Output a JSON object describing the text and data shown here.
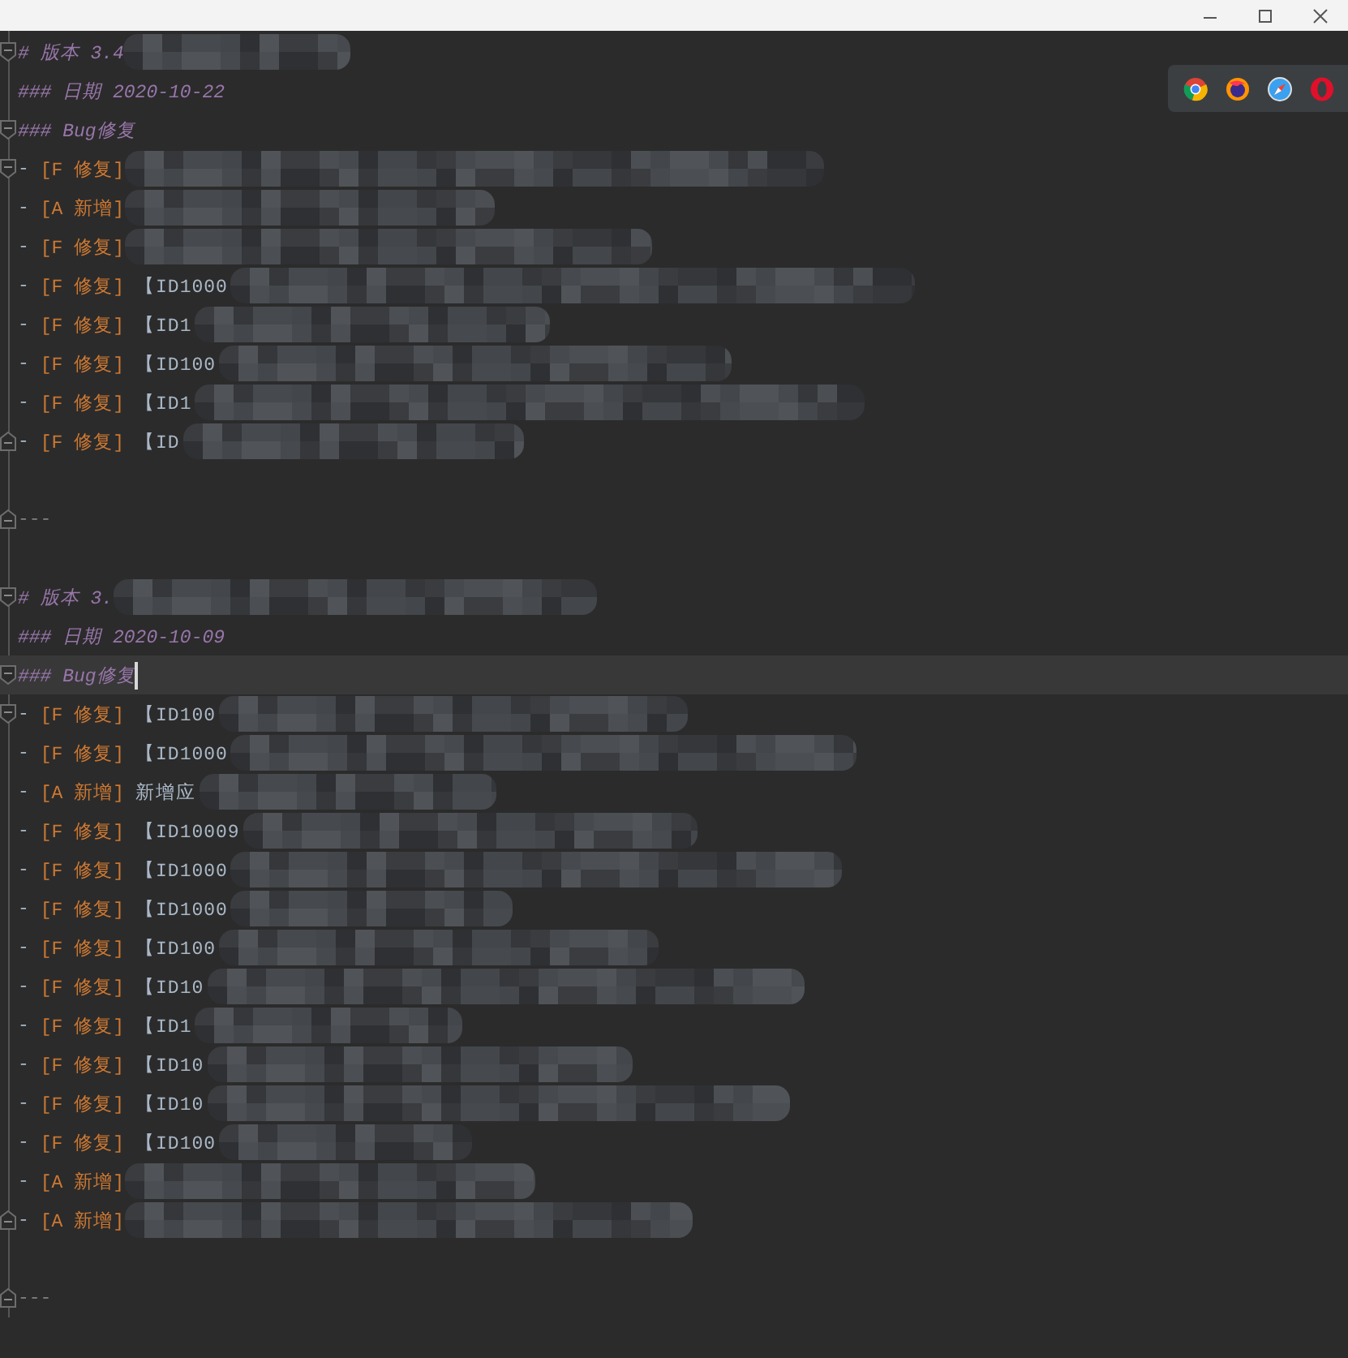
{
  "lines": [
    {
      "kind": "heading",
      "text": "# 版本 3.4",
      "redacted": true,
      "fold_start": true,
      "fold_end": false,
      "current": false
    },
    {
      "kind": "date",
      "text": "### 日期 2020-10-22",
      "redacted": false,
      "fold_start": false,
      "fold_end": false,
      "current": false
    },
    {
      "kind": "section",
      "text": "### Bug修复",
      "redacted": false,
      "fold_start": true,
      "fold_end": false,
      "current": false
    },
    {
      "kind": "item",
      "marker": "-",
      "tag": "[F 修复]",
      "redacted": true,
      "fold_start": true,
      "fold_end": false,
      "current": false
    },
    {
      "kind": "item",
      "marker": "-",
      "tag": "[A 新增]",
      "redacted": true,
      "fold_start": false,
      "fold_end": false,
      "current": false
    },
    {
      "kind": "item",
      "marker": "-",
      "tag": "[F 修复]",
      "redacted": true,
      "fold_start": false,
      "fold_end": false,
      "current": false
    },
    {
      "kind": "item",
      "marker": "-",
      "tag": "[F 修复]",
      "text": "【ID1000",
      "redacted": true,
      "fold_start": false,
      "fold_end": false,
      "current": false
    },
    {
      "kind": "item",
      "marker": "-",
      "tag": "[F 修复]",
      "text": "【ID1",
      "redacted": true,
      "fold_start": false,
      "fold_end": false,
      "current": false
    },
    {
      "kind": "item",
      "marker": "-",
      "tag": "[F 修复]",
      "text": "【ID100",
      "redacted": true,
      "fold_start": false,
      "fold_end": false,
      "current": false
    },
    {
      "kind": "item",
      "marker": "-",
      "tag": "[F 修复]",
      "text": "【ID1",
      "redacted": true,
      "fold_start": false,
      "fold_end": false,
      "current": false
    },
    {
      "kind": "item",
      "marker": "-",
      "tag": "[F 修复]",
      "text": "【ID",
      "redacted": true,
      "fold_start": false,
      "fold_end": true,
      "current": false
    },
    {
      "kind": "blank",
      "redacted": false,
      "fold_start": false,
      "fold_end": false,
      "current": false
    },
    {
      "kind": "rule",
      "text": "---",
      "redacted": false,
      "fold_start": false,
      "fold_end": true,
      "current": false
    },
    {
      "kind": "blank",
      "redacted": false,
      "fold_start": false,
      "fold_end": false,
      "current": false
    },
    {
      "kind": "heading",
      "text": "# 版本 3.",
      "redacted": true,
      "fold_start": true,
      "fold_end": false,
      "current": false
    },
    {
      "kind": "date",
      "text": "### 日期 2020-10-09",
      "redacted": false,
      "fold_start": false,
      "fold_end": false,
      "current": false
    },
    {
      "kind": "section",
      "text": "### Bug修复",
      "redacted": false,
      "fold_start": true,
      "fold_end": false,
      "current": true
    },
    {
      "kind": "item",
      "marker": "-",
      "tag": "[F 修复]",
      "text": "【ID100",
      "redacted": true,
      "fold_start": true,
      "fold_end": false,
      "current": false
    },
    {
      "kind": "item",
      "marker": "-",
      "tag": "[F 修复]",
      "text": "【ID1000",
      "redacted": true,
      "fold_start": false,
      "fold_end": false,
      "current": false
    },
    {
      "kind": "item",
      "marker": "-",
      "tag": "[A 新增]",
      "text": "新增应",
      "redacted": true,
      "fold_start": false,
      "fold_end": false,
      "current": false
    },
    {
      "kind": "item",
      "marker": "-",
      "tag": "[F 修复]",
      "text": "【ID10009",
      "redacted": true,
      "fold_start": false,
      "fold_end": false,
      "current": false
    },
    {
      "kind": "item",
      "marker": "-",
      "tag": "[F 修复]",
      "text": "【ID1000",
      "redacted": true,
      "fold_start": false,
      "fold_end": false,
      "current": false
    },
    {
      "kind": "item",
      "marker": "-",
      "tag": "[F 修复]",
      "text": "【ID1000",
      "redacted": true,
      "fold_start": false,
      "fold_end": false,
      "current": false
    },
    {
      "kind": "item",
      "marker": "-",
      "tag": "[F 修复]",
      "text": "【ID100",
      "redacted": true,
      "fold_start": false,
      "fold_end": false,
      "current": false
    },
    {
      "kind": "item",
      "marker": "-",
      "tag": "[F 修复]",
      "text": "【ID10",
      "redacted": true,
      "fold_start": false,
      "fold_end": false,
      "current": false
    },
    {
      "kind": "item",
      "marker": "-",
      "tag": "[F 修复]",
      "text": "【ID1",
      "redacted": true,
      "fold_start": false,
      "fold_end": false,
      "current": false
    },
    {
      "kind": "item",
      "marker": "-",
      "tag": "[F 修复]",
      "text": "【ID10",
      "redacted": true,
      "fold_start": false,
      "fold_end": false,
      "current": false
    },
    {
      "kind": "item",
      "marker": "-",
      "tag": "[F 修复]",
      "text": "【ID10",
      "redacted": true,
      "fold_start": false,
      "fold_end": false,
      "current": false
    },
    {
      "kind": "item",
      "marker": "-",
      "tag": "[F 修复]",
      "text": "【ID100",
      "redacted": true,
      "fold_start": false,
      "fold_end": false,
      "current": false
    },
    {
      "kind": "item",
      "marker": "-",
      "tag": "[A 新增]",
      "redacted": true,
      "fold_start": false,
      "fold_end": false,
      "current": false
    },
    {
      "kind": "item",
      "marker": "-",
      "tag": "[A 新增]",
      "redacted": true,
      "fold_start": false,
      "fold_end": true,
      "current": false
    },
    {
      "kind": "blank",
      "redacted": false,
      "fold_start": false,
      "fold_end": false,
      "current": false
    },
    {
      "kind": "rule",
      "text": "---",
      "redacted": false,
      "fold_start": false,
      "fold_end": true,
      "current": false
    }
  ]
}
